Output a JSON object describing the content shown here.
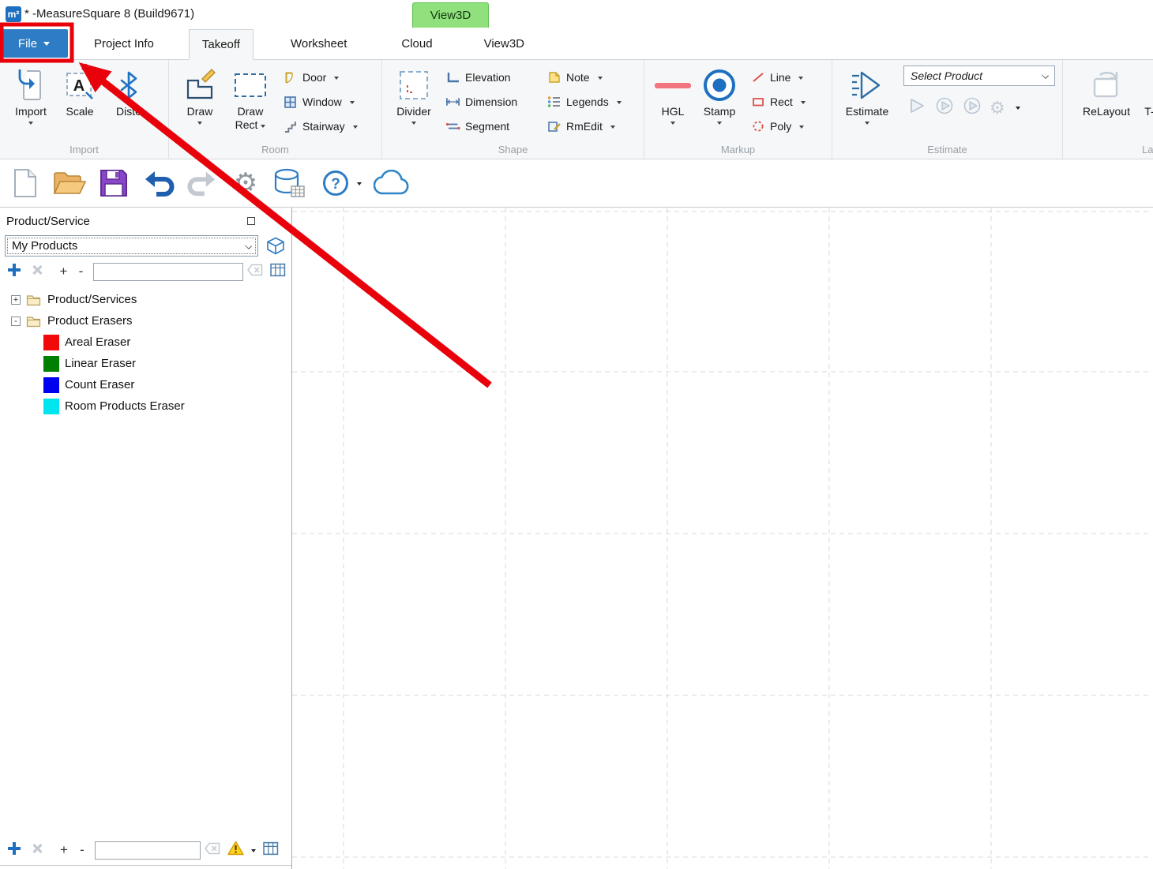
{
  "window": {
    "logo": "m²",
    "title": "* -MeasureSquare 8 (Build9671)"
  },
  "contextual_tab": "View3D",
  "file_menu": "File",
  "tabs": [
    {
      "label": "Project Info",
      "active": false
    },
    {
      "label": "Takeoff",
      "active": true
    },
    {
      "label": "Worksheet",
      "active": false
    },
    {
      "label": "Cloud",
      "active": false
    },
    {
      "label": "View3D",
      "active": false
    }
  ],
  "ribbon": {
    "groups": {
      "import": {
        "label": "Import",
        "import_btn": "Import",
        "scale_btn": "Scale",
        "disto_btn": "Disto"
      },
      "room": {
        "label": "Room",
        "draw_btn": "Draw",
        "draw_rect_line1": "Draw",
        "draw_rect_line2": "Rect",
        "door_btn": "Door",
        "window_btn": "Window",
        "stairway_btn": "Stairway"
      },
      "shape": {
        "label": "Shape",
        "divider_btn": "Divider",
        "elevation_btn": "Elevation",
        "dimension_btn": "Dimension",
        "segment_btn": "Segment",
        "note_btn": "Note",
        "legends_btn": "Legends",
        "rmedit_btn": "RmEdit"
      },
      "markup": {
        "label": "Markup",
        "hgl_btn": "HGL",
        "stamp_btn": "Stamp",
        "line_btn": "Line",
        "rect_btn": "Rect",
        "poly_btn": "Poly"
      },
      "estimate": {
        "label": "Estimate",
        "estimate_btn": "Estimate",
        "select_product": "Select Product"
      },
      "layout": {
        "label": "Layout",
        "relayout_btn": "ReLayout",
        "tsquare_btn": "T-Square"
      }
    }
  },
  "quick_toolbar": {
    "icons": [
      "new-document",
      "open-project",
      "save",
      "undo",
      "redo",
      "settings",
      "product-database",
      "help",
      "cloud-sync"
    ]
  },
  "panel": {
    "title": "Product/Service",
    "source_selector": "My Products",
    "search_value": "",
    "bottom_search_value": "",
    "tree": [
      {
        "label": "Product/Services",
        "toggle": "+",
        "expanded": false
      },
      {
        "label": "Product Erasers",
        "toggle": "-",
        "expanded": true
      }
    ],
    "erasers": [
      {
        "label": "Areal Eraser",
        "color": "#f00a0a"
      },
      {
        "label": "Linear Eraser",
        "color": "#008000"
      },
      {
        "label": "Count Eraser",
        "color": "#0000f0"
      },
      {
        "label": "Room Products Eraser",
        "color": "#00e5ee"
      }
    ]
  },
  "canvas": {
    "grid_spacing_px": 205,
    "grid_color": "#d9d9d9",
    "grid_style": "dashed"
  },
  "annotation": {
    "color": "#e8000a"
  },
  "colors": {
    "file_button_bg": "#2e7cc4",
    "contextual_tab_bg": "#90e07e",
    "icon_blue": "#2e6da4",
    "markup_red": "#d9534f",
    "hgl_pink": "#f2747f",
    "save_purple": "#8a46c8"
  }
}
